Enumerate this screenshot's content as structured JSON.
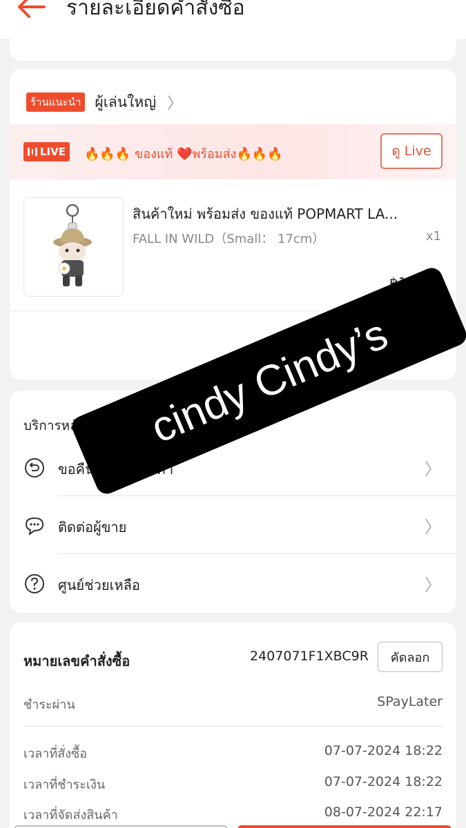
{
  "header": {
    "title": "รายละเอียดคำสั่งซื้อ"
  },
  "shop": {
    "badge": "ร้านแนะนำ",
    "name": "ผู้เล่นใหญ่",
    "live": {
      "badge": "LIVE",
      "text": "🔥🔥🔥 ของแท้ ❤️พร้อมส่ง🔥🔥🔥",
      "button": "ดู Live"
    },
    "product": {
      "name": "สินค้าใหม่ พร้อมส่ง ของแท้ POPMART LA...",
      "variant": "FALL IN WILD（Small： 17cm）",
      "qty": "x1",
      "price": "฿1,6"
    }
  },
  "service": {
    "title": "บริการหลัง",
    "items": [
      {
        "label": "ขอคืนเงิน/คืนสินค้า",
        "icon": "return-icon"
      },
      {
        "label": "ติดต่อผู้ขาย",
        "icon": "chat-icon"
      },
      {
        "label": "ศูนย์ช่วยเหลือ",
        "icon": "help-icon"
      }
    ]
  },
  "order": {
    "number_label": "หมายเลขคำสั่งซื้อ",
    "number": "2407071F1XBC9R",
    "copy_button": "คัดลอก",
    "payment_label": "ชำระผ่าน",
    "payment_value": "SPayLater",
    "rows": [
      {
        "label": "เวลาที่สั่งซื้อ",
        "value": "07-07-2024 18:22"
      },
      {
        "label": "เวลาที่ชำระเงิน",
        "value": "07-07-2024 18:22"
      },
      {
        "label": "เวลาที่จัดส่งสินค้า",
        "value": "08-07-2024 22:17"
      }
    ]
  },
  "watermark": {
    "text": "cindy Cindy’s"
  },
  "colors": {
    "accent": "#ee4d2d",
    "background": "#f2f2f2"
  }
}
